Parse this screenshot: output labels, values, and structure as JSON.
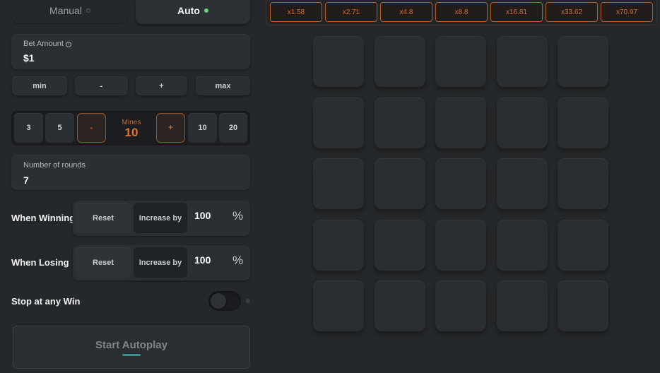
{
  "tabs": {
    "manual": "Manual",
    "auto": "Auto"
  },
  "bet": {
    "label": "Bet Amount",
    "value": "$1"
  },
  "quick_buttons": [
    "min",
    "-",
    "+",
    "max"
  ],
  "mines": {
    "presets_left": [
      "3",
      "5"
    ],
    "decrement": "-",
    "label": "Mines",
    "value": "10",
    "increment": "+",
    "presets_right": [
      "10",
      "20"
    ]
  },
  "rounds": {
    "label": "Number of rounds",
    "value": "7"
  },
  "when_winning": {
    "label": "When Winning",
    "reset": "Reset",
    "increase": "Increase by",
    "value": "100",
    "unit": "%"
  },
  "when_losing": {
    "label": "When Losing",
    "reset": "Reset",
    "increase": "Increase by",
    "value": "100",
    "unit": "%"
  },
  "stop_at_win": {
    "label": "Stop at any Win",
    "enabled": false
  },
  "start_button": "Start Autoplay",
  "multipliers": [
    "x1.58",
    "x2.71",
    "x4.8",
    "x8.8",
    "x16.81",
    "x33.62",
    "x70.97"
  ],
  "grid": {
    "rows": 5,
    "cols": 5
  },
  "colors": {
    "accent": "#d8692f",
    "active_dot": "#6bd27a",
    "background": "#232629"
  }
}
